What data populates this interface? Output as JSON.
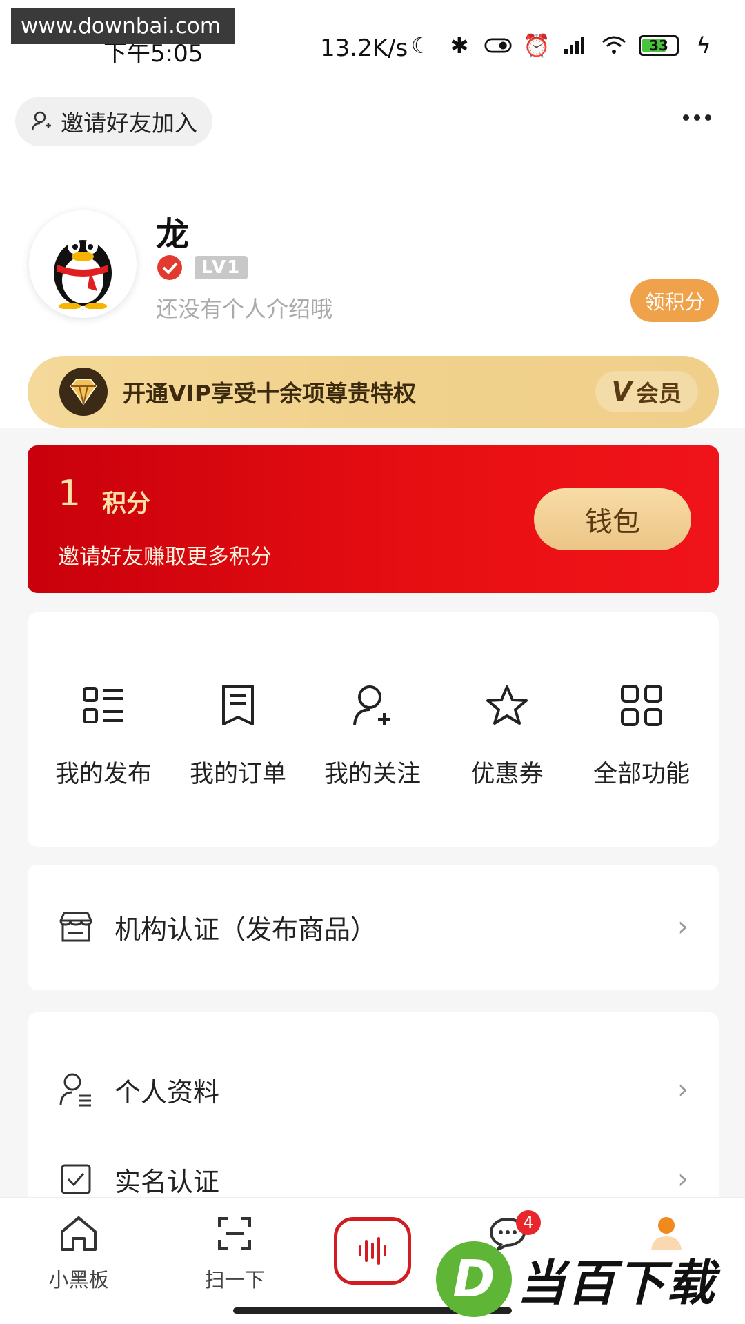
{
  "watermark_top": "www.downbai.com",
  "status_bar": {
    "time": "下午5:05",
    "net_speed": "13.2K/s",
    "battery": "33"
  },
  "header": {
    "invite_label": "邀请好友加入"
  },
  "profile": {
    "name": "龙",
    "level": "LV1",
    "bio": "还没有个人介绍哦",
    "points_button": "领积分"
  },
  "vip": {
    "text": "开通VIP享受十余项尊贵特权",
    "tag_mark": "V",
    "tag_label": "会员"
  },
  "points_card": {
    "value": "1",
    "unit": "积分",
    "subtitle": "邀请好友赚取更多积分",
    "wallet_button": "钱包"
  },
  "shortcuts": [
    {
      "label": "我的发布",
      "icon": "list-icon"
    },
    {
      "label": "我的订单",
      "icon": "receipt-icon"
    },
    {
      "label": "我的关注",
      "icon": "user-follow-icon"
    },
    {
      "label": "优惠券",
      "icon": "star-icon"
    },
    {
      "label": "全部功能",
      "icon": "grid-icon"
    }
  ],
  "menu": {
    "org_cert": "机构认证（发布商品）",
    "profile_info": "个人资料",
    "real_name": "实名认证"
  },
  "tabbar": {
    "home": "小黑板",
    "scan": "扫一下",
    "messages_badge": "4"
  },
  "watermark_bottom": {
    "logo": "D",
    "text": "当百下载"
  },
  "colors": {
    "accent_red": "#e80f12",
    "gold": "#f0a24a",
    "vip_gold": "#f5d99a"
  }
}
